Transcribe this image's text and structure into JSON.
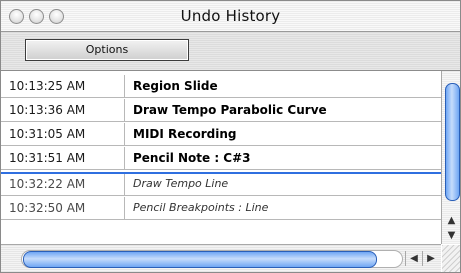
{
  "window": {
    "title": "Undo History"
  },
  "toolbar": {
    "options_label": "Options"
  },
  "history": {
    "rows": [
      {
        "time": "10:13:25 AM",
        "action": "Region Slide",
        "state": "done"
      },
      {
        "time": "10:13:36 AM",
        "action": "Draw Tempo Parabolic Curve",
        "state": "done"
      },
      {
        "time": "10:31:05 AM",
        "action": "MIDI Recording",
        "state": "done"
      },
      {
        "time": "10:31:51 AM",
        "action": "Pencil Note : C#3",
        "state": "done"
      },
      {
        "time": "10:32:22 AM",
        "action": "Draw Tempo Line",
        "state": "undone"
      },
      {
        "time": "10:32:50 AM",
        "action": "Pencil Breakpoints : Line",
        "state": "undone"
      }
    ]
  },
  "icons": {
    "close": "close-icon",
    "minimize": "minimize-icon",
    "zoom": "zoom-icon",
    "scroll_up": "triangle-up",
    "scroll_down": "triangle-down",
    "scroll_left": "triangle-left",
    "scroll_right": "triangle-right"
  },
  "colors": {
    "undo_marker": "#2f6fe0",
    "scroll_thumb": "#6fa6f4"
  }
}
